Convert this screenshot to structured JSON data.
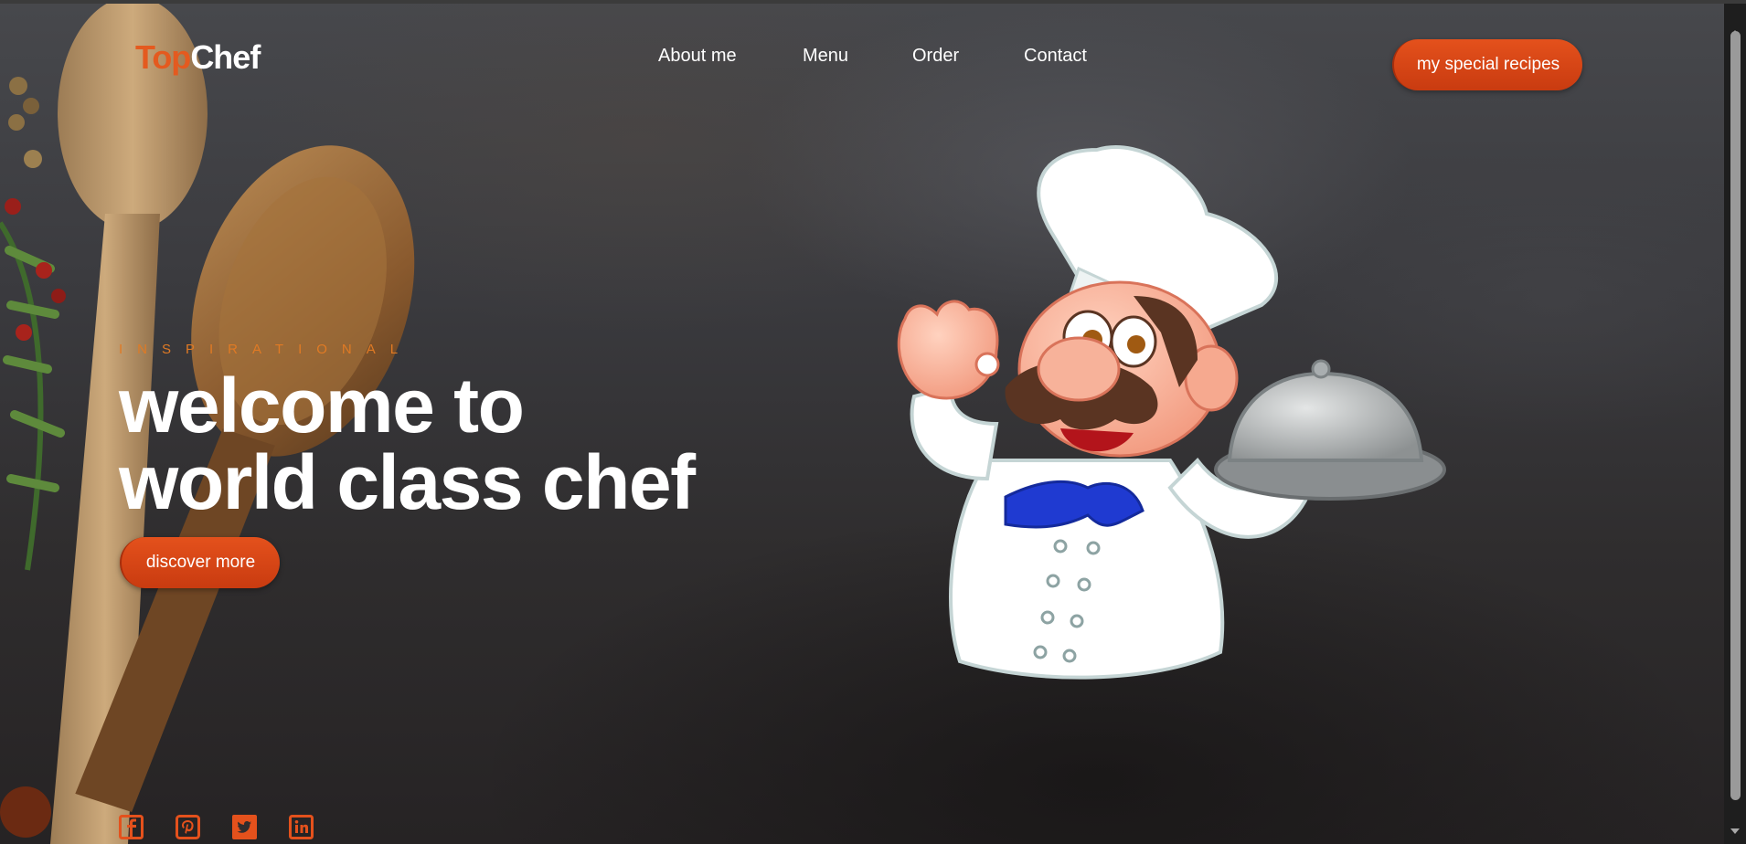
{
  "header": {
    "logo_part1": "Top",
    "logo_part2": "Chef",
    "nav": [
      "About me",
      "Menu",
      "Order",
      "Contact"
    ],
    "cta_label": "my special recipes"
  },
  "hero": {
    "eyebrow": "INSPIRATIONAL",
    "title_line1": "welcome to",
    "title_line2": "world class chef",
    "button_label": "discover more"
  },
  "socials": [
    "facebook-icon",
    "pinterest-icon",
    "twitter-icon",
    "linkedin-icon"
  ],
  "colors": {
    "accent": "#e4511c",
    "eyebrow": "#e07a24",
    "text": "#ffffff",
    "background": "#2f2d2e"
  }
}
